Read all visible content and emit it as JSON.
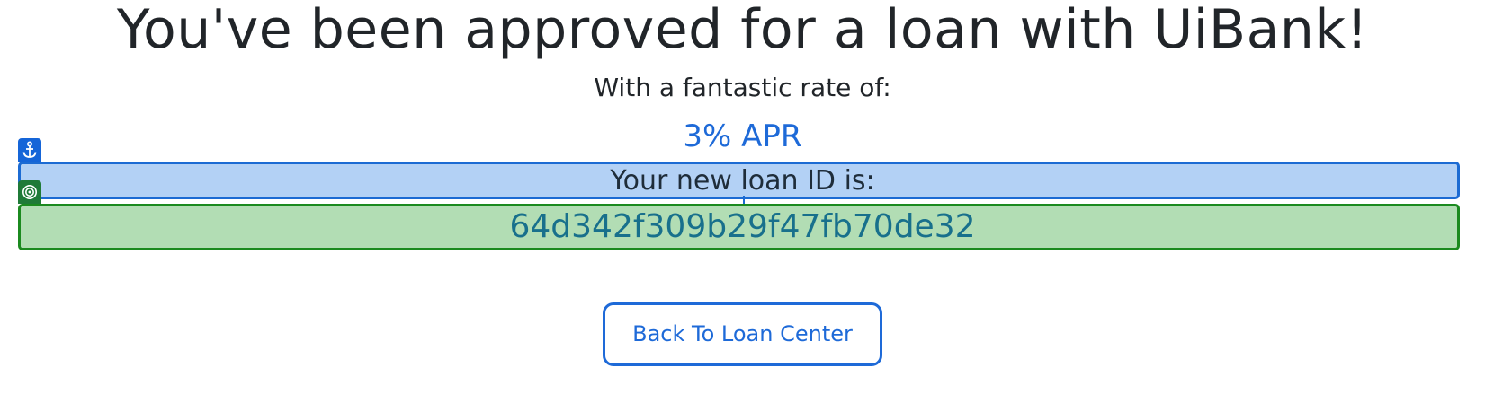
{
  "headline": "You've been approved for a loan with UiBank!",
  "rate": {
    "label": "With a fantastic rate of:",
    "value": "3% APR"
  },
  "loan": {
    "label": "Your new loan ID is:",
    "id": "64d342f309b29f47fb70de32"
  },
  "actions": {
    "back_label": "Back To Loan Center"
  },
  "overlay": {
    "anchor_icon": "anchor-icon",
    "target_icon": "target-icon",
    "anchor_color": "#1c6bd3",
    "target_color": "#1b8a1f"
  }
}
